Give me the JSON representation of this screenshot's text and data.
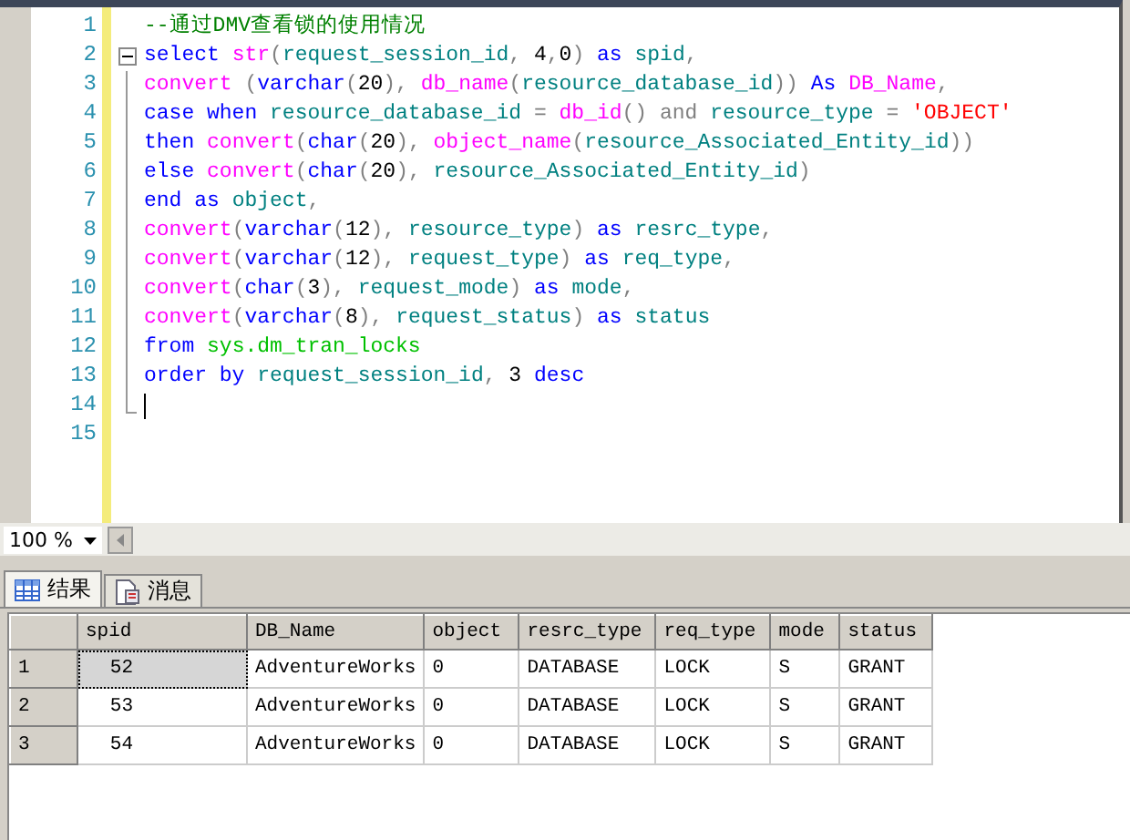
{
  "editor": {
    "fold_expanded": true,
    "lines": [
      {
        "number": "1",
        "cursor": false,
        "tokens": [
          {
            "t": "--通过DMV查看锁的使用情况",
            "kind": "comment"
          }
        ]
      },
      {
        "number": "2",
        "cursor": false,
        "tokens": [
          {
            "t": "select ",
            "kind": "kw"
          },
          {
            "t": "str",
            "kind": "fn"
          },
          {
            "t": "(",
            "kind": "op"
          },
          {
            "t": "request_session_id",
            "kind": "id"
          },
          {
            "t": ", ",
            "kind": "op"
          },
          {
            "t": "4",
            "kind": "plain"
          },
          {
            "t": ",",
            "kind": "op"
          },
          {
            "t": "0",
            "kind": "plain"
          },
          {
            "t": ") ",
            "kind": "op"
          },
          {
            "t": "as ",
            "kind": "kw"
          },
          {
            "t": "spid",
            "kind": "id"
          },
          {
            "t": ",",
            "kind": "op"
          }
        ]
      },
      {
        "number": "3",
        "cursor": false,
        "tokens": [
          {
            "t": "convert ",
            "kind": "fn"
          },
          {
            "t": "(",
            "kind": "op"
          },
          {
            "t": "varchar",
            "kind": "kw"
          },
          {
            "t": "(",
            "kind": "op"
          },
          {
            "t": "20",
            "kind": "plain"
          },
          {
            "t": "), ",
            "kind": "op"
          },
          {
            "t": "db_name",
            "kind": "fn"
          },
          {
            "t": "(",
            "kind": "op"
          },
          {
            "t": "resource_database_id",
            "kind": "id"
          },
          {
            "t": ")) ",
            "kind": "op"
          },
          {
            "t": "As ",
            "kind": "kw"
          },
          {
            "t": "DB_Name",
            "kind": "fn"
          },
          {
            "t": ",",
            "kind": "op"
          }
        ]
      },
      {
        "number": "4",
        "cursor": false,
        "tokens": [
          {
            "t": "case when ",
            "kind": "kw"
          },
          {
            "t": "resource_database_id ",
            "kind": "id"
          },
          {
            "t": "= ",
            "kind": "op"
          },
          {
            "t": "db_id",
            "kind": "fn"
          },
          {
            "t": "() and ",
            "kind": "op"
          },
          {
            "t": "resource_type ",
            "kind": "id"
          },
          {
            "t": "= ",
            "kind": "op"
          },
          {
            "t": "'OBJECT'",
            "kind": "str"
          }
        ]
      },
      {
        "number": "5",
        "cursor": false,
        "tokens": [
          {
            "t": "then ",
            "kind": "kw"
          },
          {
            "t": "convert",
            "kind": "fn"
          },
          {
            "t": "(",
            "kind": "op"
          },
          {
            "t": "char",
            "kind": "kw"
          },
          {
            "t": "(",
            "kind": "op"
          },
          {
            "t": "20",
            "kind": "plain"
          },
          {
            "t": "), ",
            "kind": "op"
          },
          {
            "t": "object_name",
            "kind": "fn"
          },
          {
            "t": "(",
            "kind": "op"
          },
          {
            "t": "resource_Associated_Entity_id",
            "kind": "id"
          },
          {
            "t": "))",
            "kind": "op"
          }
        ]
      },
      {
        "number": "6",
        "cursor": false,
        "tokens": [
          {
            "t": "else ",
            "kind": "kw"
          },
          {
            "t": "convert",
            "kind": "fn"
          },
          {
            "t": "(",
            "kind": "op"
          },
          {
            "t": "char",
            "kind": "kw"
          },
          {
            "t": "(",
            "kind": "op"
          },
          {
            "t": "20",
            "kind": "plain"
          },
          {
            "t": "), ",
            "kind": "op"
          },
          {
            "t": "resource_Associated_Entity_id",
            "kind": "id"
          },
          {
            "t": ")",
            "kind": "op"
          }
        ]
      },
      {
        "number": "7",
        "cursor": false,
        "tokens": [
          {
            "t": "end as ",
            "kind": "kw"
          },
          {
            "t": "object",
            "kind": "id"
          },
          {
            "t": ",",
            "kind": "op"
          }
        ]
      },
      {
        "number": "8",
        "cursor": false,
        "tokens": [
          {
            "t": "convert",
            "kind": "fn"
          },
          {
            "t": "(",
            "kind": "op"
          },
          {
            "t": "varchar",
            "kind": "kw"
          },
          {
            "t": "(",
            "kind": "op"
          },
          {
            "t": "12",
            "kind": "plain"
          },
          {
            "t": "), ",
            "kind": "op"
          },
          {
            "t": "resource_type",
            "kind": "id"
          },
          {
            "t": ") ",
            "kind": "op"
          },
          {
            "t": "as ",
            "kind": "kw"
          },
          {
            "t": "resrc_type",
            "kind": "id"
          },
          {
            "t": ",",
            "kind": "op"
          }
        ]
      },
      {
        "number": "9",
        "cursor": false,
        "tokens": [
          {
            "t": "convert",
            "kind": "fn"
          },
          {
            "t": "(",
            "kind": "op"
          },
          {
            "t": "varchar",
            "kind": "kw"
          },
          {
            "t": "(",
            "kind": "op"
          },
          {
            "t": "12",
            "kind": "plain"
          },
          {
            "t": "), ",
            "kind": "op"
          },
          {
            "t": "request_type",
            "kind": "id"
          },
          {
            "t": ") ",
            "kind": "op"
          },
          {
            "t": "as ",
            "kind": "kw"
          },
          {
            "t": "req_type",
            "kind": "id"
          },
          {
            "t": ",",
            "kind": "op"
          }
        ]
      },
      {
        "number": "10",
        "cursor": false,
        "tokens": [
          {
            "t": "convert",
            "kind": "fn"
          },
          {
            "t": "(",
            "kind": "op"
          },
          {
            "t": "char",
            "kind": "kw"
          },
          {
            "t": "(",
            "kind": "op"
          },
          {
            "t": "3",
            "kind": "plain"
          },
          {
            "t": "), ",
            "kind": "op"
          },
          {
            "t": "request_mode",
            "kind": "id"
          },
          {
            "t": ") ",
            "kind": "op"
          },
          {
            "t": "as ",
            "kind": "kw"
          },
          {
            "t": "mode",
            "kind": "id"
          },
          {
            "t": ",",
            "kind": "op"
          }
        ]
      },
      {
        "number": "11",
        "cursor": false,
        "tokens": [
          {
            "t": "convert",
            "kind": "fn"
          },
          {
            "t": "(",
            "kind": "op"
          },
          {
            "t": "varchar",
            "kind": "kw"
          },
          {
            "t": "(",
            "kind": "op"
          },
          {
            "t": "8",
            "kind": "plain"
          },
          {
            "t": "), ",
            "kind": "op"
          },
          {
            "t": "request_status",
            "kind": "id"
          },
          {
            "t": ") ",
            "kind": "op"
          },
          {
            "t": "as ",
            "kind": "kw"
          },
          {
            "t": "status",
            "kind": "id"
          }
        ]
      },
      {
        "number": "12",
        "cursor": false,
        "tokens": [
          {
            "t": "from ",
            "kind": "kw"
          },
          {
            "t": "sys.dm_tran_locks",
            "kind": "sys"
          }
        ]
      },
      {
        "number": "13",
        "cursor": false,
        "tokens": [
          {
            "t": "order by ",
            "kind": "kw"
          },
          {
            "t": "request_session_id",
            "kind": "id"
          },
          {
            "t": ", ",
            "kind": "op"
          },
          {
            "t": "3 ",
            "kind": "plain"
          },
          {
            "t": "desc",
            "kind": "kw"
          }
        ]
      },
      {
        "number": "14",
        "cursor": true
      },
      {
        "number": "15",
        "cursor": false
      }
    ]
  },
  "zoom": {
    "value": "100 %"
  },
  "result_tabs": [
    {
      "label": "结果",
      "kind": "grid",
      "selected": true
    },
    {
      "label": "消息",
      "kind": "messages",
      "selected": false
    }
  ],
  "grid": {
    "columns": [
      "spid",
      "DB_Name",
      "object",
      "resrc_type",
      "req_type",
      "mode",
      "status"
    ],
    "rows": [
      {
        "number": "1",
        "selected": true,
        "cells": [
          "52",
          "AdventureWorks",
          "0",
          "DATABASE",
          "LOCK",
          "S",
          "GRANT"
        ]
      },
      {
        "number": "2",
        "selected": false,
        "cells": [
          "53",
          "AdventureWorks",
          "0",
          "DATABASE",
          "LOCK",
          "S",
          "GRANT"
        ]
      },
      {
        "number": "3",
        "selected": false,
        "cells": [
          "54",
          "AdventureWorks",
          "0",
          "DATABASE",
          "LOCK",
          "S",
          "GRANT"
        ]
      }
    ]
  }
}
